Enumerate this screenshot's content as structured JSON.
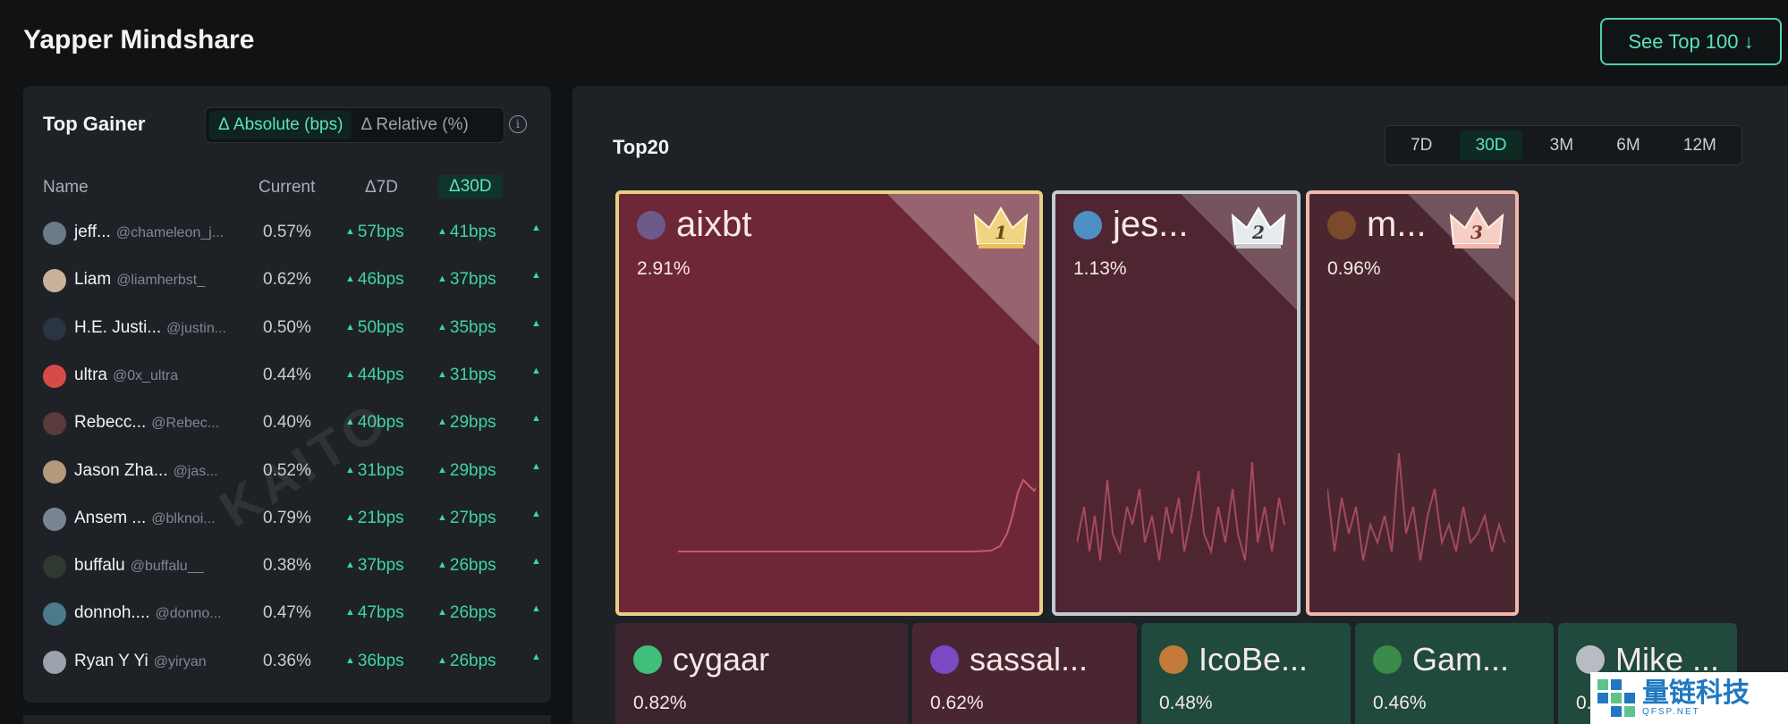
{
  "header": {
    "title": "Yapper Mindshare",
    "see_top_label": "See Top 100 ↓"
  },
  "top_gainer": {
    "title": "Top Gainer",
    "toggle_absolute": "Δ Absolute (bps)",
    "toggle_relative": "Δ Relative (%)",
    "columns": {
      "name": "Name",
      "current": "Current",
      "d7": "Δ7D",
      "d30": "Δ30D"
    },
    "rows": [
      {
        "name": "jeff...",
        "handle": "@chameleon_j...",
        "current": "0.57%",
        "d7": "57bps",
        "d30": "41bps",
        "avatar_color": "#6c7a89"
      },
      {
        "name": "Liam",
        "handle": "@liamherbst_",
        "current": "0.62%",
        "d7": "46bps",
        "d30": "37bps",
        "avatar_color": "#c8b29a"
      },
      {
        "name": "H.E. Justi...",
        "handle": "@justin...",
        "current": "0.50%",
        "d7": "50bps",
        "d30": "35bps",
        "avatar_color": "#2a3442"
      },
      {
        "name": "ultra",
        "handle": "@0x_ultra",
        "current": "0.44%",
        "d7": "44bps",
        "d30": "31bps",
        "avatar_color": "#d84a4a"
      },
      {
        "name": "Rebecc...",
        "handle": "@Rebec...",
        "current": "0.40%",
        "d7": "40bps",
        "d30": "29bps",
        "avatar_color": "#5a3a3a"
      },
      {
        "name": "Jason Zha...",
        "handle": "@jas...",
        "current": "0.52%",
        "d7": "31bps",
        "d30": "29bps",
        "avatar_color": "#b59a7a"
      },
      {
        "name": "Ansem ...",
        "handle": "@blknoi...",
        "current": "0.79%",
        "d7": "21bps",
        "d30": "27bps",
        "avatar_color": "#7a8594"
      },
      {
        "name": "buffalu",
        "handle": "@buffalu__",
        "current": "0.38%",
        "d7": "37bps",
        "d30": "26bps",
        "avatar_color": "#2e3a30"
      },
      {
        "name": "donnoh....",
        "handle": "@donno...",
        "current": "0.47%",
        "d7": "47bps",
        "d30": "26bps",
        "avatar_color": "#4a7a8c"
      },
      {
        "name": "Ryan Y Yi",
        "handle": "@yiryan",
        "current": "0.36%",
        "d7": "36bps",
        "d30": "26bps",
        "avatar_color": "#9aa2ab"
      }
    ]
  },
  "top20": {
    "title": "Top20",
    "periods": [
      "7D",
      "30D",
      "3M",
      "6M",
      "12M"
    ],
    "active_period": "30D",
    "tiles": [
      {
        "name": "aixbt",
        "pct": "2.91%",
        "rank": "1",
        "bg": "#6e2736",
        "border": "#e8cf86"
      },
      {
        "name": "jes...",
        "pct": "1.13%",
        "rank": "2",
        "bg": "#4f2531",
        "border": "#c4c9cf"
      },
      {
        "name": "m...",
        "pct": "0.96%",
        "rank": "3",
        "bg": "#4a2631",
        "border": "#f0b7aa"
      },
      {
        "name": "cygaar",
        "pct": "0.82%",
        "bg": "#3d2530"
      },
      {
        "name": "sassal...",
        "pct": "0.62%",
        "bg": "#4a2633"
      },
      {
        "name": "IcoBe...",
        "pct": "0.48%",
        "bg": "#1f4a3d"
      },
      {
        "name": "Gam...",
        "pct": "0.46%",
        "bg": "#1f4a3d"
      },
      {
        "name": "Mike ...",
        "pct": "0.",
        "bg": "#1f4a3d"
      }
    ]
  },
  "watermark": "KAITO",
  "logo": {
    "text": "量链科技",
    "sub": "QFSP.NET"
  }
}
